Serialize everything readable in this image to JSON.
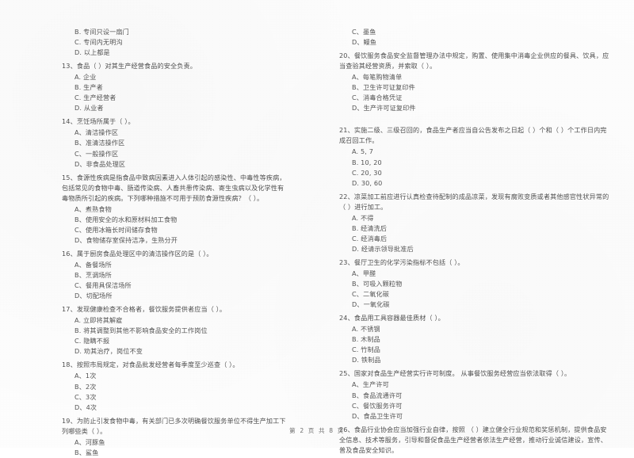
{
  "document": {
    "type": "exam-paper-scan",
    "footer": {
      "label": "第 2 页 共 8 页",
      "current_page": "2",
      "total_pages": "8"
    }
  },
  "left_column": {
    "continued_options": [
      "B. 专间只设一扇门",
      "C. 专间内无明沟",
      "D. 以上都是"
    ],
    "questions": [
      {
        "number": "13",
        "stem": "13、食品（      ）对其生产经营食品的安全负责。",
        "options": [
          "A. 企业",
          "B. 生产者",
          "C. 生产经营者",
          "D. 从业者"
        ]
      },
      {
        "number": "14",
        "stem": "14、烹饪场所属于（      ）。",
        "options": [
          "A、清洁操作区",
          "B、准清洁操作区",
          "C、一般操作区",
          "D、非食品处理区"
        ]
      },
      {
        "number": "15",
        "stem": "15、食源性疾病是指食品中致病因素进入人体引起的感染性、中毒性等疾病，包括常见的食物中毒、肠道传染病、人畜共患传染病、寄生虫病以及化学性有毒物质所引起的疾病。下列哪种措施不可用于预防食源性疾病？（      ）。",
        "options": [
          "A、煮熟食物",
          "B、使用安全的水和原材料加工食物",
          "C、使用冰箱长时间储存食物",
          "D、食物储存室保持洁净，生熟分开"
        ]
      },
      {
        "number": "16",
        "stem": "16、属于厨房食品处理区中的清洁操作区的是（      ）。",
        "options": [
          "A、备餐场所",
          "B、烹调场所",
          "C、餐用具保洁场所",
          "D、切配场所"
        ]
      },
      {
        "number": "17",
        "stem": "17、发现健康检查不合格者，餐饮服务提供者应当（      ）。",
        "options": [
          "A. 立即将其解雇",
          "B. 将其调整到其他不影响食品安全的工作岗位",
          "C. 隐瞒不报",
          "D. 劝其治疗，岗位不变"
        ]
      },
      {
        "number": "18",
        "stem": "18、按照市局规定，对食品批发经营者每季度至少巡查（      ）。",
        "options": [
          "A、1次",
          "B、2次",
          "C、3次",
          "D、4次"
        ]
      },
      {
        "number": "19",
        "stem": "19、为防止引发食物中毒，有关部门已多次明确餐饮服务单位不得生产加工下列哪些类（      ）。",
        "options": [
          "A、河豚鱼",
          "B、鲨鱼"
        ]
      }
    ]
  },
  "right_column": {
    "continued_options": [
      "C、墨鱼",
      "D、鳗鱼"
    ],
    "questions": [
      {
        "number": "20",
        "stem": "20、餐饮服务食品安全监督管理办法中规定，购置、使用集中消毒企业供应的餐具、饮具，应当查验其经营资质，并索取（      ）。",
        "options": [
          "A、每笔购物清单",
          "B、卫生许可证复印件",
          "C、消毒合格凭证",
          "D、生产许可证复印件"
        ]
      },
      {
        "number": "21",
        "stem": "21、实施二级、三级召回的，食品生产者应当自公告发布之日起（      ）个和（      ）个工作日内完成召回工作。",
        "options": [
          "A. 5, 7",
          "B. 10, 20",
          "C. 20, 30",
          "D. 30, 60"
        ]
      },
      {
        "number": "22",
        "stem": "22、凉菜加工前应进行认真检查待配制的成品凉菜，发现有腐败变质或者其他感官性状异常的（      ）进行加工。",
        "options": [
          "A. 不得",
          "B. 经清洗后",
          "C. 经消毒后",
          "D. 经请示领导批准后"
        ]
      },
      {
        "number": "23",
        "stem": "23、餐厅卫生的化学污染指标不包括（      ）。",
        "options": [
          "A、甲醛",
          "B、可吸入颗粒物",
          "C、二氧化碳",
          "D、一氧化碳"
        ]
      },
      {
        "number": "24",
        "stem": "24、食品用工具容器最佳质材（      ）。",
        "options": [
          "A. 不锈钢",
          "B. 木制品",
          "C. 竹制品",
          "D. 铁制品"
        ]
      },
      {
        "number": "25",
        "stem": "25、国家对食品生产经营实行许可制度。 从事餐饮服务经营应当依法取得（      ）。",
        "options": [
          "A、生产许可",
          "B、食品流通许可",
          "C、餐饮服务许可",
          "D、食品卫生许可"
        ]
      },
      {
        "number": "26",
        "stem": "26、食品行业协会应当加强行业自律，按照 （      ）建立健全行业规范和奖惩机制，提供食品安全信息、技术等服务，引导和督促食品生产经营者依法生产经营，推动行业诚信建设，宣传、普及食品安全知识。",
        "options": []
      }
    ]
  }
}
